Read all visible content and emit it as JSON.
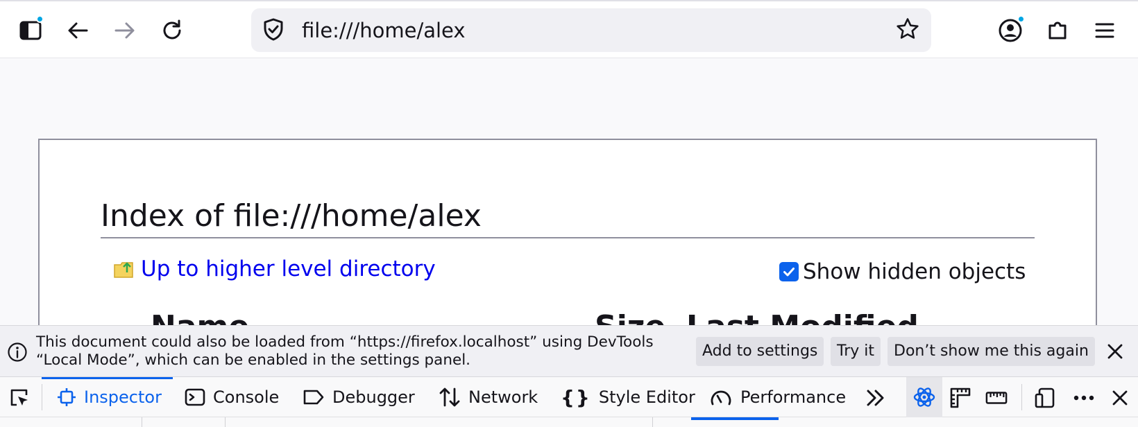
{
  "browser": {
    "url": "file:///home/alex",
    "icons": {
      "sidebar": "sidebar-icon",
      "back": "back-arrow-icon",
      "forward": "forward-arrow-icon",
      "reload": "reload-icon",
      "site_info": "shield-icon",
      "bookmark": "star-icon",
      "account": "account-icon",
      "extensions": "puzzle-icon",
      "menu": "hamburger-menu-icon"
    },
    "accent_color": "#00a6e4"
  },
  "page": {
    "title": "Index of file:///home/alex",
    "up_link": "Up to higher level directory",
    "show_hidden_label": "Show hidden objects",
    "show_hidden_checked": true,
    "columns": [
      "Name",
      "Size",
      "Last Modified"
    ]
  },
  "notification": {
    "message": "This document could also be loaded from “https://firefox.localhost” using DevTools “Local Mode”, which can be enabled in the settings panel.",
    "buttons": {
      "add_to_settings": "Add to settings",
      "try_it": "Try it",
      "dont_show": "Don’t show me this again"
    }
  },
  "devtools": {
    "tabs": {
      "inspector": "Inspector",
      "console": "Console",
      "debugger": "Debugger",
      "network": "Network",
      "style_editor": "Style Editor",
      "performance": "Performance"
    },
    "active_tab": "Inspector",
    "active_color": "#0b62ec"
  }
}
